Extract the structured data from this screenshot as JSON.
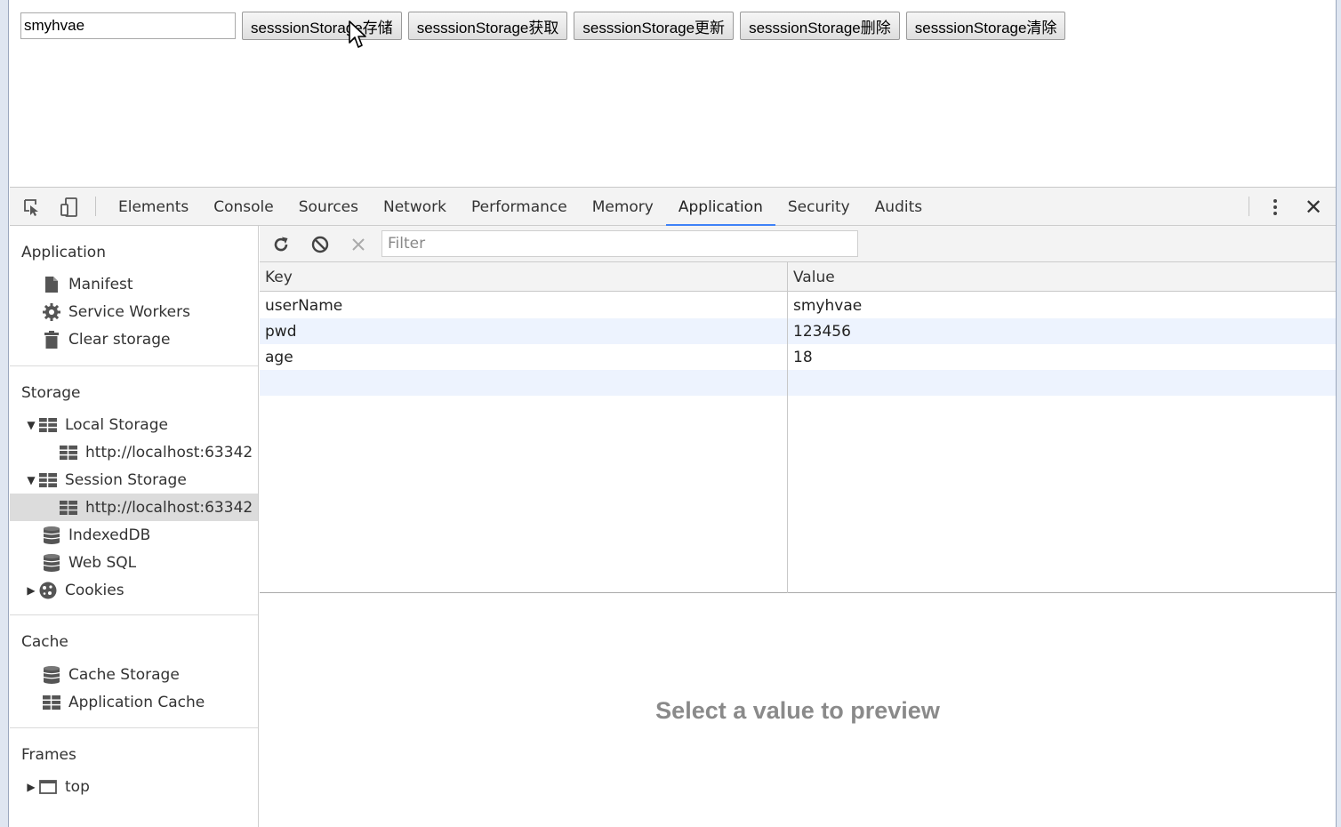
{
  "page": {
    "input_value": "smyhvae",
    "buttons": [
      "sesssionStorage存储",
      "sesssionStorage获取",
      "sesssionStorage更新",
      "sesssionStorage删除",
      "sesssionStorage清除"
    ]
  },
  "devtools": {
    "tabs": [
      "Elements",
      "Console",
      "Sources",
      "Network",
      "Performance",
      "Memory",
      "Application",
      "Security",
      "Audits"
    ],
    "active_tab": "Application",
    "accent_color": "#3e82f7"
  },
  "sidebar": {
    "application": {
      "title": "Application",
      "items": [
        {
          "label": "Manifest",
          "icon": "file-icon"
        },
        {
          "label": "Service Workers",
          "icon": "gear-icon"
        },
        {
          "label": "Clear storage",
          "icon": "trash-icon"
        }
      ]
    },
    "storage": {
      "title": "Storage",
      "local_storage": {
        "label": "Local Storage",
        "child": "http://localhost:63342"
      },
      "session_storage": {
        "label": "Session Storage",
        "child": "http://localhost:63342"
      },
      "indexeddb": "IndexedDB",
      "websql": "Web SQL",
      "cookies": "Cookies"
    },
    "cache": {
      "title": "Cache",
      "items": [
        "Cache Storage",
        "Application Cache"
      ]
    },
    "frames": {
      "title": "Frames",
      "items": [
        "top"
      ]
    }
  },
  "storage_view": {
    "filter_placeholder": "Filter",
    "columns": {
      "key": "Key",
      "value": "Value"
    },
    "rows": [
      {
        "key": "userName",
        "value": "smyhvae"
      },
      {
        "key": "pwd",
        "value": "123456"
      },
      {
        "key": "age",
        "value": "18"
      }
    ],
    "preview_text": "Select a value to preview"
  }
}
